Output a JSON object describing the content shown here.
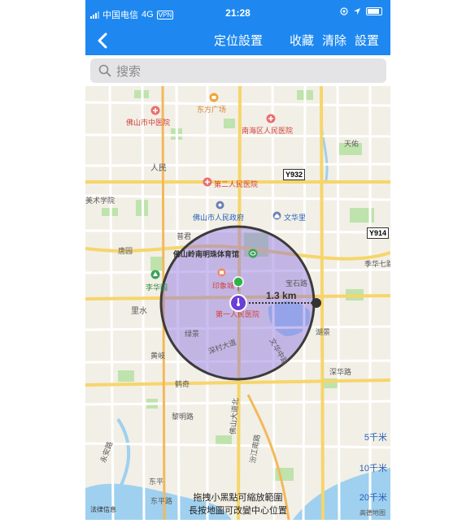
{
  "status_bar": {
    "carrier": "中国电信",
    "network": "4G",
    "vpn": "VPN",
    "time": "21:28"
  },
  "nav": {
    "title": "定位設置",
    "actions": [
      "收藏",
      "清除",
      "設置"
    ]
  },
  "search": {
    "placeholder": "搜索"
  },
  "map": {
    "radius_label": "1.3 km",
    "hint_line1": "拖拽小黑點可縮放範圍",
    "hint_line2": "長按地圖可改變中心位置",
    "scale_labels": [
      "5千米",
      "10千米",
      "20千米"
    ],
    "legal": "法律信息",
    "watermark": "高德地图",
    "road_tags": [
      "Y932",
      "Y914"
    ],
    "places": [
      "佛山市中医院",
      "南海区人民医院",
      "东方广场",
      "第二人民医院",
      "佛山市人民政府",
      "文华里",
      "佛山岭南明珠体育馆",
      "印象城",
      "第一人民医院",
      "李华园",
      "普君",
      "唐园",
      "天佑",
      "鹤奇",
      "湖景",
      "深华路",
      "黎明路",
      "东平路",
      "季华七路",
      "人民",
      "里水",
      "绿景",
      "深村大道",
      "文华中路",
      "美术学院",
      "黄岐",
      "东平",
      "永安路",
      "宝石路",
      "汾江南路",
      "佛山大道北"
    ]
  },
  "colors": {
    "nav_bg": "#1e88f0",
    "radius_fill": "#8a6fe0",
    "pin_purple": "#6b3fd6",
    "pin_green": "#2fb44a",
    "water": "#9fd0ef",
    "park": "#bfe3ac"
  }
}
